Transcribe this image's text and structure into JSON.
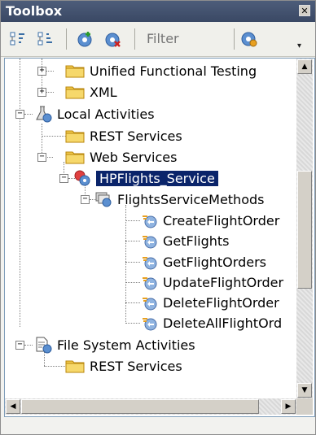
{
  "window": {
    "title": "Toolbox",
    "close_glyph": "✕"
  },
  "toolbar": {
    "icons": [
      "sort-ascending-icon",
      "sort-descending-icon",
      "add-service-icon",
      "remove-service-icon",
      "refresh-service-icon"
    ],
    "filter_placeholder": "Filter",
    "overflow_glyph": "▾"
  },
  "tree": {
    "unified_functional_testing": "Unified Functional Testing",
    "xml": "XML",
    "local_activities": "Local Activities",
    "rest_services_1": "REST Services",
    "web_services": "Web Services",
    "hpflights_service": "HPFlights_Service",
    "flights_service_methods": "FlightsServiceMethods",
    "methods": [
      "CreateFlightOrder",
      "GetFlights",
      "GetFlightOrders",
      "UpdateFlightOrder",
      "DeleteFlightOrder",
      "DeleteAllFlightOrd"
    ],
    "file_system_activities": "File System Activities",
    "rest_services_2": "REST Services"
  },
  "colors": {
    "titlebar": "#3f4e6c",
    "selection": "#0a246a",
    "folder": "#f0c040"
  }
}
